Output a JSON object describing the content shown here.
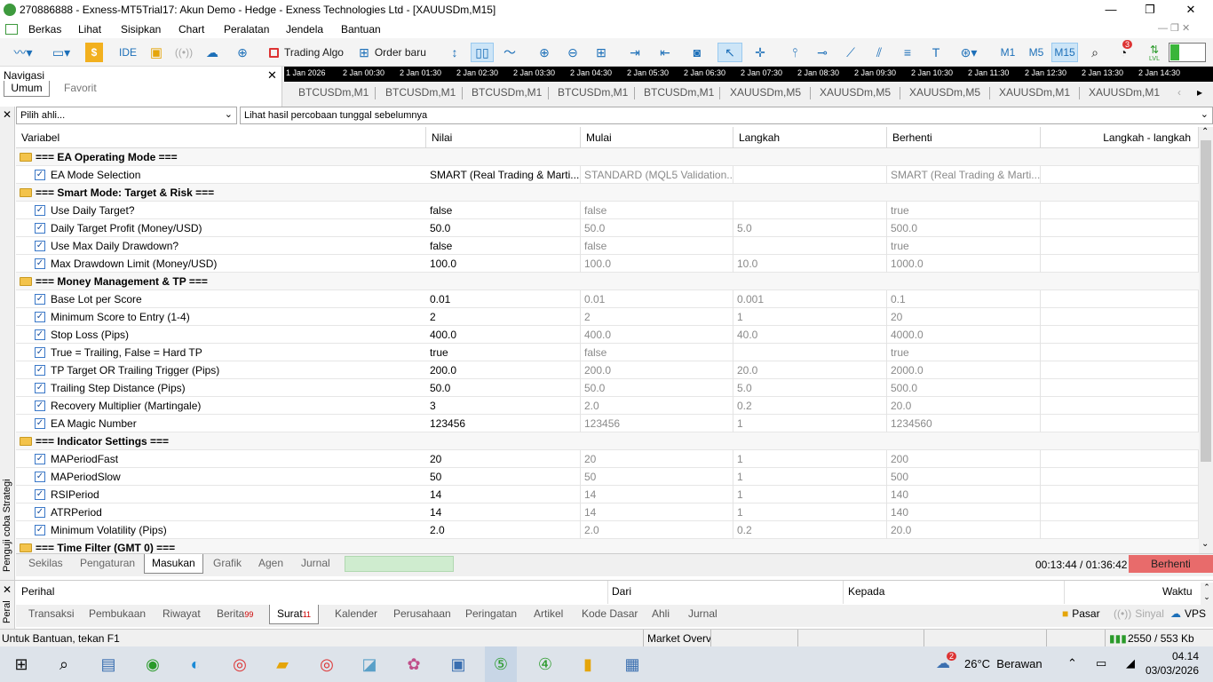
{
  "window": {
    "title": "270886888 - Exness-MT5Trial17: Akun Demo - Hedge - Exness Technologies Ltd - [XAUUSDm,M15]",
    "min": "—",
    "max": "❐",
    "close": "✕"
  },
  "menu": [
    "Berkas",
    "Lihat",
    "Sisipkan",
    "Chart",
    "Peralatan",
    "Jendela",
    "Bantuan"
  ],
  "toolbar": {
    "ide": "IDE",
    "trading_algo": "Trading Algo",
    "order_baru": "Order baru",
    "timeframes": [
      "M1",
      "M5",
      "M15"
    ],
    "active_timeframe": "M15",
    "notif_count": "3",
    "lvl": "LVL"
  },
  "navigator": {
    "title": "Navigasi",
    "tabs": [
      "Umum",
      "Favorit"
    ]
  },
  "time_axis": [
    "1 Jan 2026",
    "2 Jan 00:30",
    "2 Jan 01:30",
    "2 Jan 02:30",
    "2 Jan 03:30",
    "2 Jan 04:30",
    "2 Jan 05:30",
    "2 Jan 06:30",
    "2 Jan 07:30",
    "2 Jan 08:30",
    "2 Jan 09:30",
    "2 Jan 10:30",
    "2 Jan 11:30",
    "2 Jan 12:30",
    "2 Jan 13:30",
    "2 Jan 14:30"
  ],
  "chart_tabs": [
    "BTCUSDm,M1",
    "BTCUSDm,M1",
    "BTCUSDm,M1",
    "BTCUSDm,M1",
    "BTCUSDm,M1",
    "XAUUSDm,M5",
    "XAUUSDm,M5",
    "XAUUSDm,M5",
    "XAUUSDm,M1",
    "XAUUSDm,M1"
  ],
  "tester": {
    "side_label": "Penguji coba Strategi",
    "expert_placeholder": "Pilih ahli...",
    "history_select": "Lihat hasil percobaan tunggal sebelumnya",
    "columns": [
      "Variabel",
      "Nilai",
      "Mulai",
      "Langkah",
      "Berhenti",
      "Langkah - langkah"
    ],
    "rows": [
      {
        "group": true,
        "name": "=== EA Operating Mode ==="
      },
      {
        "name": "EA Mode Selection",
        "value": "SMART (Real Trading & Marti...",
        "start": "STANDARD (MQL5 Validation...",
        "step": "",
        "stop": "SMART (Real Trading & Marti..."
      },
      {
        "group": true,
        "name": "=== Smart Mode: Target & Risk ==="
      },
      {
        "name": "Use Daily Target?",
        "value": "false",
        "start": "false",
        "step": "",
        "stop": "true"
      },
      {
        "name": "Daily Target Profit (Money/USD)",
        "value": "50.0",
        "start": "50.0",
        "step": "5.0",
        "stop": "500.0"
      },
      {
        "name": "Use Max Daily Drawdown?",
        "value": "false",
        "start": "false",
        "step": "",
        "stop": "true"
      },
      {
        "name": "Max Drawdown Limit (Money/USD)",
        "value": "100.0",
        "start": "100.0",
        "step": "10.0",
        "stop": "1000.0"
      },
      {
        "group": true,
        "name": "=== Money Management & TP ==="
      },
      {
        "name": "Base Lot per Score",
        "value": "0.01",
        "start": "0.01",
        "step": "0.001",
        "stop": "0.1"
      },
      {
        "name": "Minimum Score to Entry (1-4)",
        "value": "2",
        "start": "2",
        "step": "1",
        "stop": "20"
      },
      {
        "name": "Stop Loss (Pips)",
        "value": "400.0",
        "start": "400.0",
        "step": "40.0",
        "stop": "4000.0"
      },
      {
        "name": "True = Trailing, False = Hard TP",
        "value": "true",
        "start": "false",
        "step": "",
        "stop": "true"
      },
      {
        "name": "TP Target OR Trailing Trigger (Pips)",
        "value": "200.0",
        "start": "200.0",
        "step": "20.0",
        "stop": "2000.0"
      },
      {
        "name": "Trailing Step Distance (Pips)",
        "value": "50.0",
        "start": "50.0",
        "step": "5.0",
        "stop": "500.0"
      },
      {
        "name": "Recovery Multiplier (Martingale)",
        "value": "3",
        "start": "2.0",
        "step": "0.2",
        "stop": "20.0"
      },
      {
        "name": "EA Magic Number",
        "value": "123456",
        "start": "123456",
        "step": "1",
        "stop": "1234560"
      },
      {
        "group": true,
        "name": "=== Indicator Settings ==="
      },
      {
        "name": "MAPeriodFast",
        "value": "20",
        "start": "20",
        "step": "1",
        "stop": "200"
      },
      {
        "name": "MAPeriodSlow",
        "value": "50",
        "start": "50",
        "step": "1",
        "stop": "500"
      },
      {
        "name": "RSIPeriod",
        "value": "14",
        "start": "14",
        "step": "1",
        "stop": "140"
      },
      {
        "name": "ATRPeriod",
        "value": "14",
        "start": "14",
        "step": "1",
        "stop": "140"
      },
      {
        "name": "Minimum Volatility (Pips)",
        "value": "2.0",
        "start": "2.0",
        "step": "0.2",
        "stop": "20.0"
      },
      {
        "group": true,
        "name": "=== Time Filter (GMT 0) ==="
      }
    ],
    "tabs": [
      "Sekilas",
      "Pengaturan",
      "Masukan",
      "Grafik",
      "Agen",
      "Jurnal"
    ],
    "active_tab": "Masukan",
    "timer": "00:13:44 / 01:36:42",
    "stop_button": "Berhenti"
  },
  "mail": {
    "side_label": "Peral",
    "columns": [
      "Perihal",
      "Dari",
      "Kepada",
      "Waktu"
    ],
    "tabs": [
      {
        "label": "Transaksi",
        "badge": ""
      },
      {
        "label": "Pembukaan",
        "badge": ""
      },
      {
        "label": "Riwayat",
        "badge": ""
      },
      {
        "label": "Berita",
        "badge": "99"
      },
      {
        "label": "Surat",
        "badge": "11"
      },
      {
        "label": "Kalender",
        "badge": ""
      },
      {
        "label": "Perusahaan",
        "badge": ""
      },
      {
        "label": "Peringatan",
        "badge": ""
      },
      {
        "label": "Artikel",
        "badge": ""
      },
      {
        "label": "Kode Dasar",
        "badge": ""
      },
      {
        "label": "Ahli",
        "badge": ""
      },
      {
        "label": "Jurnal",
        "badge": ""
      }
    ],
    "active_tab": "Surat",
    "right": {
      "pasar": "Pasar",
      "sinyal": "Sinyal",
      "vps": "VPS"
    }
  },
  "status": {
    "help": "Untuk Bantuan, tekan F1",
    "market": "Market Overv",
    "traffic": "2550 / 553 Kb"
  },
  "taskbar": {
    "weather_badge": "2",
    "weather": "26°C  Berawan",
    "time": "04.14",
    "date": "03/03/2026"
  },
  "colors": {
    "stop": "#e86b6b",
    "accent": "#1c6fb8",
    "folder": "#f3c34b"
  }
}
